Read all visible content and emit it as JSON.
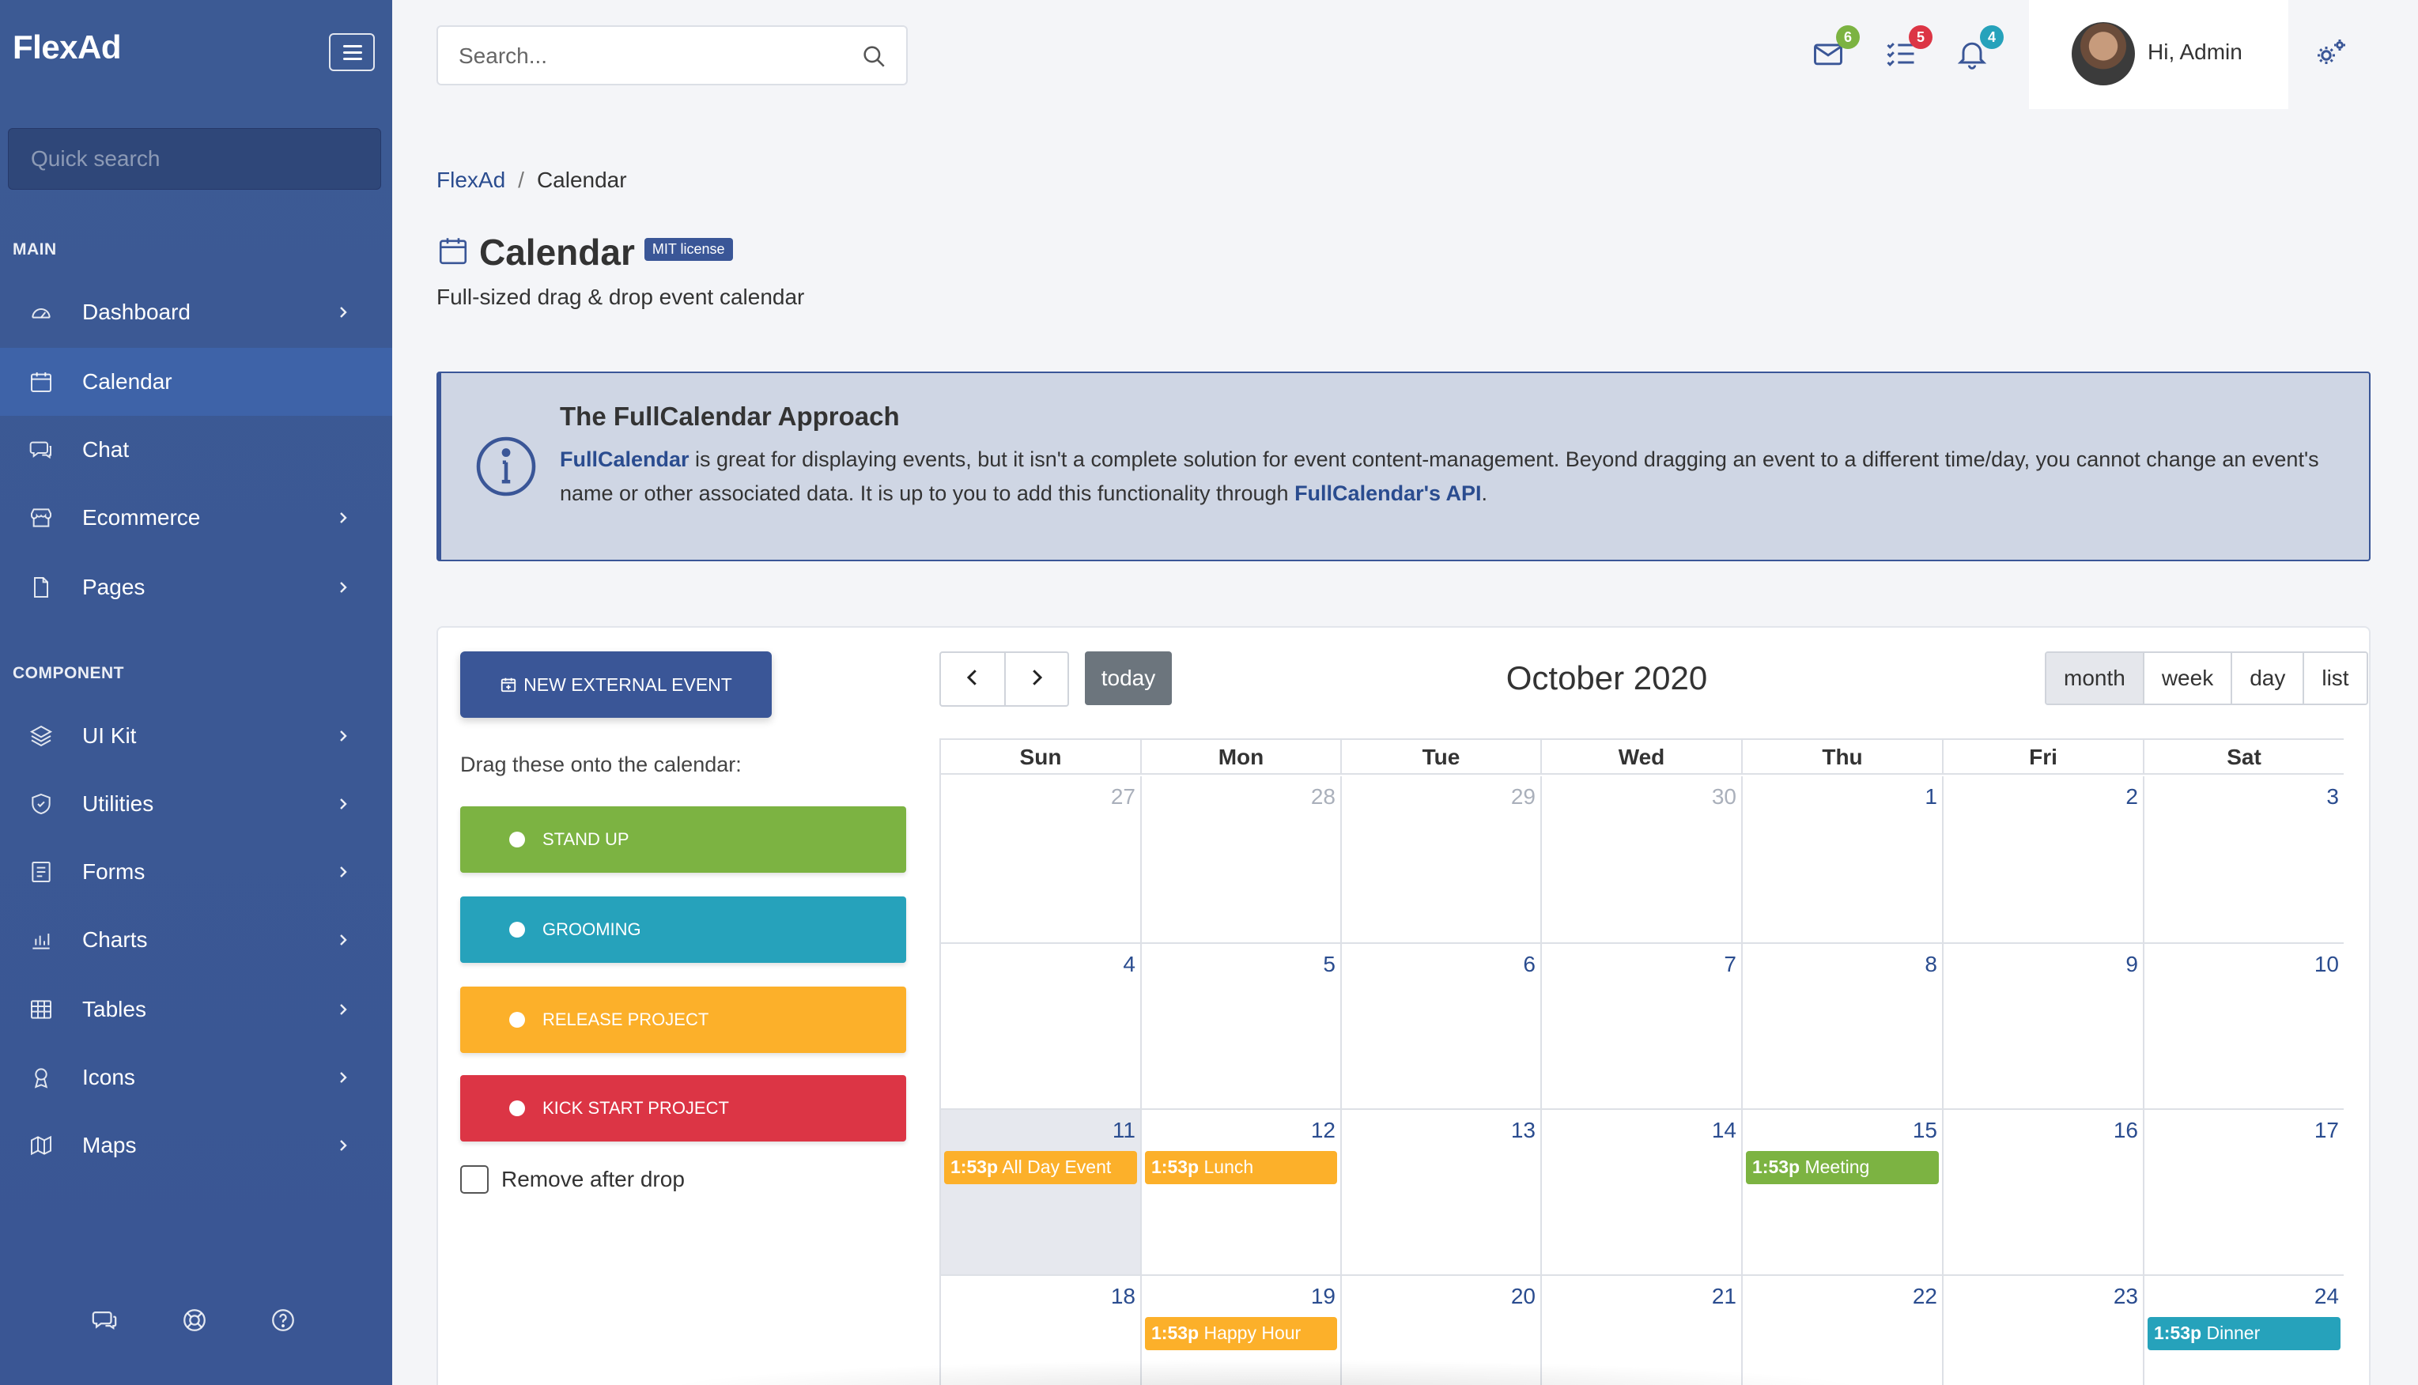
{
  "colors": {
    "sidebar": "#3c5a94",
    "primary": "#3a5697",
    "green": "#7cb342",
    "teal": "#26a2bb",
    "amber": "#fcb02a",
    "red": "#dc3545",
    "badge_green": "#7cb342",
    "badge_red": "#dc3545",
    "badge_teal": "#26a2bb"
  },
  "sidebar": {
    "brand": "FlexAd",
    "menu_icon": "hamburger-icon",
    "quick_search_placeholder": "Quick search",
    "main_label": "MAIN",
    "component_label": "COMPONENT",
    "items": [
      {
        "label": "Dashboard",
        "icon": "gauge-icon",
        "chevron": true
      },
      {
        "label": "Calendar",
        "icon": "calendar-icon",
        "chevron": false,
        "active": true
      },
      {
        "label": "Chat",
        "icon": "chat-icon",
        "chevron": false
      },
      {
        "label": "Ecommerce",
        "icon": "store-icon",
        "chevron": true
      },
      {
        "label": "Pages",
        "icon": "file-icon",
        "chevron": true
      }
    ],
    "component_items": [
      {
        "label": "UI Kit",
        "icon": "layers-icon",
        "chevron": true
      },
      {
        "label": "Utilities",
        "icon": "shield-icon",
        "chevron": true
      },
      {
        "label": "Forms",
        "icon": "form-icon",
        "chevron": true
      },
      {
        "label": "Charts",
        "icon": "bar-chart-icon",
        "chevron": true
      },
      {
        "label": "Tables",
        "icon": "table-icon",
        "chevron": true
      },
      {
        "label": "Icons",
        "icon": "award-icon",
        "chevron": true
      },
      {
        "label": "Maps",
        "icon": "map-icon",
        "chevron": true
      }
    ],
    "footer_icons": [
      "chat-icon",
      "lifebuoy-icon",
      "help-icon"
    ]
  },
  "topbar": {
    "search_placeholder": "Search...",
    "mail_badge": "6",
    "tasks_badge": "5",
    "bell_badge": "4",
    "user_greeting": "Hi, Admin"
  },
  "breadcrumb": {
    "root": "FlexAd",
    "separator": "/",
    "current": "Calendar"
  },
  "page": {
    "title": "Calendar",
    "license_badge": "MIT license",
    "subtitle": "Full-sized drag & drop event calendar"
  },
  "info": {
    "title": "The FullCalendar Approach",
    "link1": "FullCalendar",
    "text1": " is great for displaying events, but it isn't a complete solution for event content-management. Beyond dragging an event to a different time/day, you cannot change an event's name or other associated data. It is up to you to add this functionality through ",
    "link2": "FullCalendar's API",
    "text2": "."
  },
  "external": {
    "new_button": "NEW EXTERNAL EVENT",
    "hint": "Drag these onto the calendar:",
    "events": [
      {
        "label": "STAND UP",
        "color": "#7cb342"
      },
      {
        "label": "GROOMING",
        "color": "#26a2bb"
      },
      {
        "label": "RELEASE PROJECT",
        "color": "#fcb02a"
      },
      {
        "label": "KICK START PROJECT",
        "color": "#dc3545"
      }
    ],
    "remove_label": "Remove after drop"
  },
  "calendar": {
    "title": "October 2020",
    "today_label": "today",
    "views": [
      "month",
      "week",
      "day",
      "list"
    ],
    "active_view": "month",
    "weekdays": [
      "Sun",
      "Mon",
      "Tue",
      "Wed",
      "Thu",
      "Fri",
      "Sat"
    ],
    "weeks": [
      [
        {
          "d": "27",
          "other": true
        },
        {
          "d": "28",
          "other": true
        },
        {
          "d": "29",
          "other": true
        },
        {
          "d": "30",
          "other": true
        },
        {
          "d": "1"
        },
        {
          "d": "2"
        },
        {
          "d": "3"
        }
      ],
      [
        {
          "d": "4"
        },
        {
          "d": "5"
        },
        {
          "d": "6"
        },
        {
          "d": "7"
        },
        {
          "d": "8"
        },
        {
          "d": "9"
        },
        {
          "d": "10"
        }
      ],
      [
        {
          "d": "11",
          "today": true
        },
        {
          "d": "12"
        },
        {
          "d": "13"
        },
        {
          "d": "14"
        },
        {
          "d": "15"
        },
        {
          "d": "16"
        },
        {
          "d": "17"
        }
      ],
      [
        {
          "d": "18"
        },
        {
          "d": "19"
        },
        {
          "d": "20"
        },
        {
          "d": "21"
        },
        {
          "d": "22"
        },
        {
          "d": "23"
        },
        {
          "d": "24"
        }
      ]
    ],
    "events": [
      {
        "week": 2,
        "day": 0,
        "time": "1:53p",
        "title": "All Day Event",
        "color": "#fcb02a"
      },
      {
        "week": 2,
        "day": 1,
        "time": "1:53p",
        "title": "Lunch",
        "color": "#fcb02a"
      },
      {
        "week": 2,
        "day": 4,
        "time": "1:53p",
        "title": "Meeting",
        "color": "#7cb342"
      },
      {
        "week": 3,
        "day": 1,
        "time": "1:53p",
        "title": "Happy Hour",
        "color": "#fcb02a"
      },
      {
        "week": 3,
        "day": 6,
        "time": "1:53p",
        "title": "Dinner",
        "color": "#26a2bb"
      }
    ]
  }
}
